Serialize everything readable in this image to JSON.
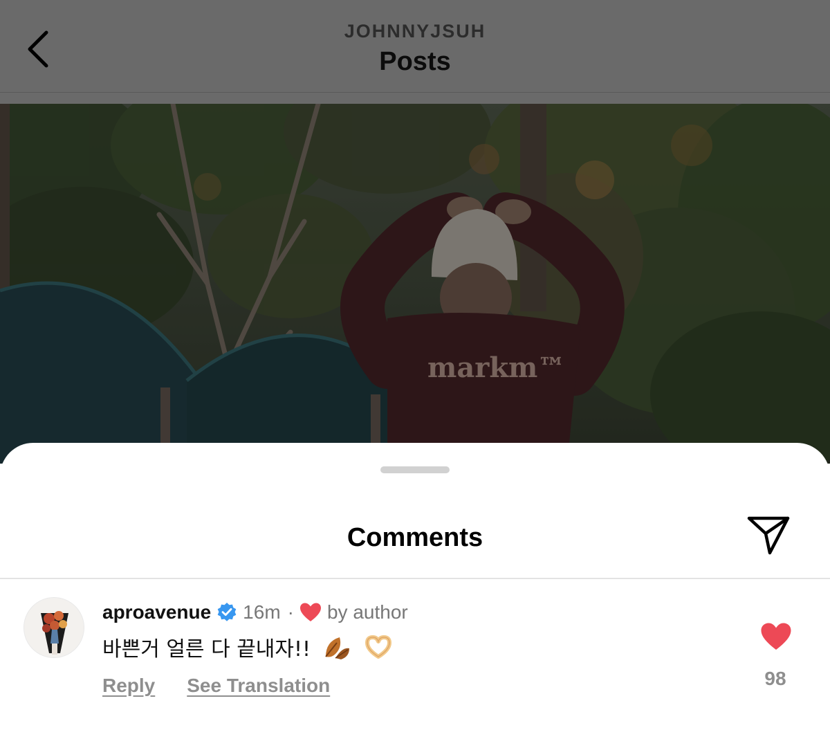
{
  "header": {
    "username": "JOHNNYJSUH",
    "title": "Posts",
    "back_icon": "chevron-left-icon"
  },
  "post": {
    "photo_description_icon": "post-photo",
    "shirt_text": "markm™"
  },
  "comments_sheet": {
    "title": "Comments",
    "share_icon": "paper-plane-icon",
    "comments": [
      {
        "username": "aproavenue",
        "verified": true,
        "time": "16m",
        "separator": "·",
        "liked_by_author_label": "by author",
        "text": "바쁜거 얼른 다 끝내자!!",
        "emojis": [
          "fallen-leaf-emoji",
          "heart-hands-emoji"
        ],
        "reply_label": "Reply",
        "translate_label": "See Translation",
        "like_count": "98",
        "liked": true
      }
    ]
  },
  "colors": {
    "overlay_gray": "#6a6a6a",
    "like_red": "#ed4956",
    "verified_blue": "#3897f0",
    "secondary_text": "#8e8e8e"
  }
}
